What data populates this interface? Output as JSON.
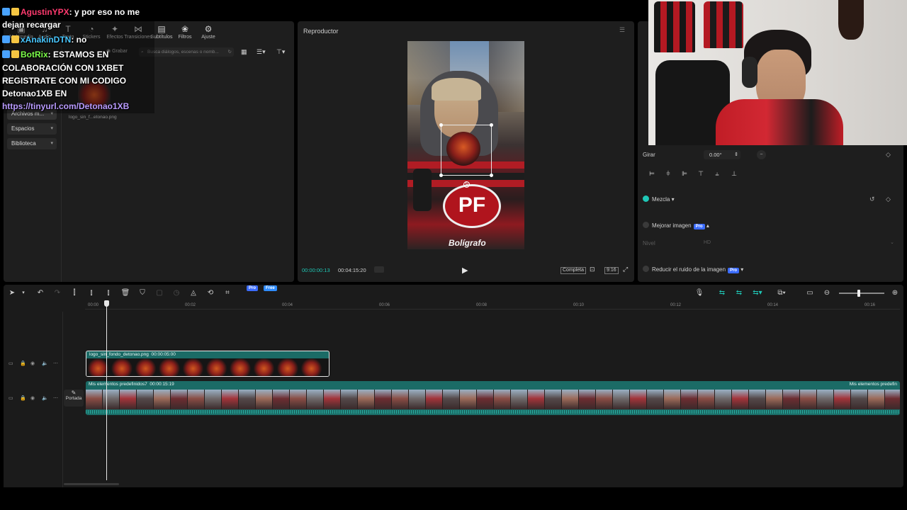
{
  "toolbar": {
    "items": [
      {
        "label": "Multimedia",
        "icon": "media-icon"
      },
      {
        "label": "Audio",
        "icon": "audio-icon"
      },
      {
        "label": "Texto",
        "icon": "text-icon"
      },
      {
        "label": "Stickers",
        "icon": "sticker-icon"
      },
      {
        "label": "Efectos",
        "icon": "effects-icon"
      },
      {
        "label": "Transiciones",
        "icon": "transition-icon"
      },
      {
        "label": "Subtítulos",
        "icon": "subtitles-icon"
      },
      {
        "label": "Filtros",
        "icon": "filter-icon"
      },
      {
        "label": "Ajuste",
        "icon": "adjust-icon"
      }
    ]
  },
  "media": {
    "record_label": "Grabar",
    "search_placeholder": "Busca diálogos, escenas o nomb...",
    "file_name": "logo_sin_f...etonao.png"
  },
  "left_nav": {
    "items": [
      "Archivos m...",
      "Espacios",
      "Biblioteca"
    ]
  },
  "chat": [
    {
      "user": "AgustinYPX",
      "user_color": "#ff3a6e",
      "text": ": y por eso no me"
    },
    {
      "user": "",
      "user_color": "#ffffff",
      "text": "dejan recargar"
    },
    {
      "user": "xAnakinDTN",
      "user_color": "#49c7ff",
      "text": ": no"
    },
    {
      "user": "BotRix",
      "user_color": "#7cff4a",
      "text": ": ESTAMOS EN"
    },
    {
      "user": "",
      "user_color": "#ffffff",
      "text": "COLABORACIÓN CON 1XBET"
    },
    {
      "user": "",
      "user_color": "#ffffff",
      "text": "REGISTRATE CON MI CODIGO"
    },
    {
      "user": "",
      "user_color": "#ffffff",
      "text": "Detonao1XB EN"
    },
    {
      "user": "",
      "user_color": "#b99bff",
      "text": "https://tinyurl.com/Detonao1XB"
    }
  ],
  "player": {
    "title": "Reproductor",
    "current_time": "00:00:00:13",
    "total_time": "00:04:15:20",
    "quality_label": "Completa",
    "ratio_label": "9:16",
    "video_text": "Bolígrafo",
    "sticker_text": "PF"
  },
  "properties": {
    "rotate_label": "Girar",
    "rotate_value": "0.00°",
    "blend_label": "Mezcla",
    "enhance_label": "Mejorar imagen",
    "enhance_sub": "Nivel",
    "enhance_value": "HD",
    "denoise_label": "Reducir el ruido de la imagen",
    "pro_badge": "Pro",
    "free_badge": "Free"
  },
  "timeline": {
    "ruler": [
      "00:00",
      "00:02",
      "00:04",
      "00:06",
      "00:08",
      "00:10",
      "00:12",
      "00:14",
      "00:16"
    ],
    "overlay_clip": {
      "name": "logo_sin_fondo_detonao.png",
      "duration": "00:00:05:00"
    },
    "main_clip": {
      "name": "Mis elementos predefinidos7",
      "duration": "00:00:15:19",
      "end_label": "Mis elementos predefin"
    },
    "cover_label": "Portada"
  },
  "colors": {
    "accent": "#1fc7b6",
    "clip_teal": "#1b6b66",
    "panel": "#1e1e1e",
    "bg": "#000000"
  }
}
